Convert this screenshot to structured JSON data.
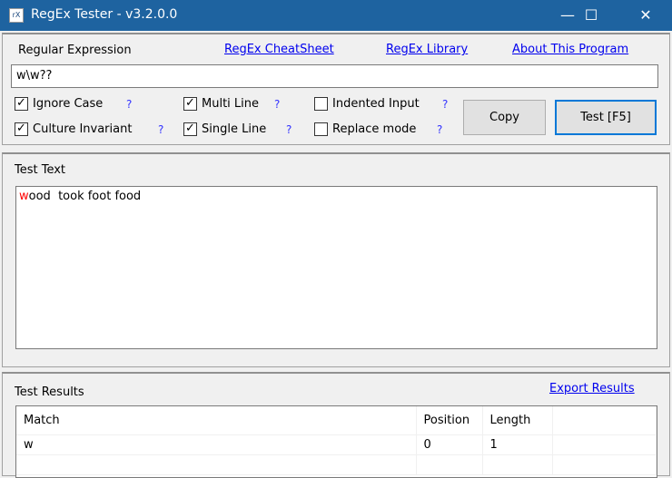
{
  "window": {
    "title": "RegEx Tester - v3.2.0.0",
    "icon_text": "rX",
    "minimize": "—",
    "maximize": "☐",
    "close": "✕",
    "accent": "#1e63a0"
  },
  "regex": {
    "label": "Regular Expression",
    "links": [
      "RegEx CheatSheet",
      "RegEx Library",
      "About This Program"
    ],
    "value": "w\\w??"
  },
  "options": [
    {
      "label": "Ignore Case",
      "checked": true,
      "help": "?"
    },
    {
      "label": "Culture Invariant",
      "checked": true,
      "help": "?"
    },
    {
      "label": "Multi Line",
      "checked": true,
      "help": "?"
    },
    {
      "label": "Single Line",
      "checked": true,
      "help": "?"
    },
    {
      "label": "Indented Input",
      "checked": false,
      "help": "?"
    },
    {
      "label": "Replace mode",
      "checked": false,
      "help": "?"
    }
  ],
  "buttons": {
    "copy": "Copy",
    "test": "Test [F5]"
  },
  "test_text": {
    "label": "Test Text",
    "highlight": "w",
    "rest": "ood  took foot food",
    "highlight_color": "#ff0000"
  },
  "results": {
    "label": "Test Results",
    "export": "Export Results",
    "columns": [
      "Match",
      "Position",
      "Length"
    ],
    "rows": [
      [
        "w",
        "0",
        "1"
      ]
    ]
  }
}
